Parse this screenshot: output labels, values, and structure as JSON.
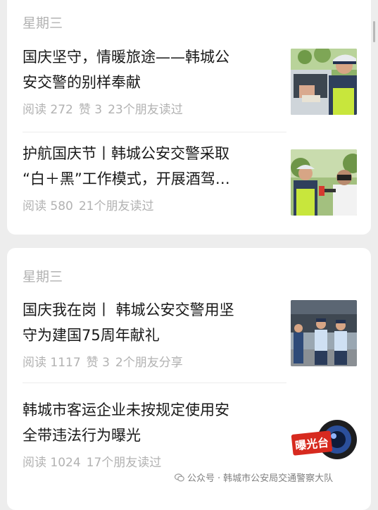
{
  "groups": [
    {
      "day": "星期三",
      "articles": [
        {
          "title_line1": "国庆坚守，情暖旅途——韩城公",
          "title_line2": "安交警的别样奉献",
          "meta": [
            "阅读 272",
            "赞 3",
            "23个朋友读过"
          ],
          "thumb": "police-officer-at-car-photo"
        },
        {
          "title_line1": "护航国庆节丨韩城公安交警采取",
          "title_line2": "“白＋黑”工作模式，开展酒驾…",
          "meta": [
            "阅读 580",
            "21个朋友读过"
          ],
          "thumb": "police-breathalyzer-check-photo"
        }
      ]
    },
    {
      "day": "星期三",
      "articles": [
        {
          "title_line1": "国庆我在岗丨 韩城公安交警用坚",
          "title_line2": "守为建国75周年献礼",
          "meta": [
            "阅读 1117",
            "赞 3",
            "2个朋友分享"
          ],
          "thumb": "police-officers-standing-photo"
        },
        {
          "title_line1": "韩城市客运企业未按规定使用安",
          "title_line2": "全带违法行为曝光",
          "meta": [
            "阅读 1024",
            "17个朋友读过"
          ],
          "thumb": "exposure-platform-logo",
          "thumb_text": "曝光台"
        }
      ]
    }
  ],
  "source": {
    "prefix": "公众号",
    "separator": "·",
    "name": "韩城市公安局交通警察大队"
  },
  "colors": {
    "background": "#ededed",
    "card": "#ffffff",
    "title_text": "#191919",
    "secondary_text": "#b2b2b2"
  }
}
